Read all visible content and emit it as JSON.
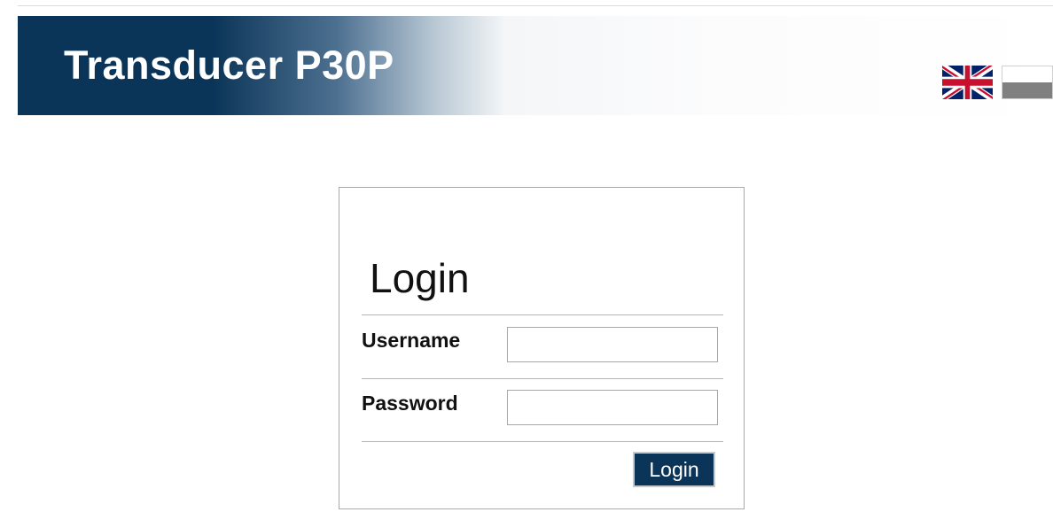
{
  "header": {
    "title": "Transducer P30P",
    "languages": [
      {
        "code": "en",
        "icon": "uk-flag-icon"
      },
      {
        "code": "pl",
        "icon": "poland-flag-icon"
      }
    ]
  },
  "login": {
    "title": "Login",
    "username_label": "Username",
    "username_value": "",
    "password_label": "Password",
    "password_value": "",
    "submit_label": "Login"
  },
  "colors": {
    "banner_dark": "#0b3558",
    "button_bg": "#0b3558",
    "border": "#a9a9a9"
  }
}
